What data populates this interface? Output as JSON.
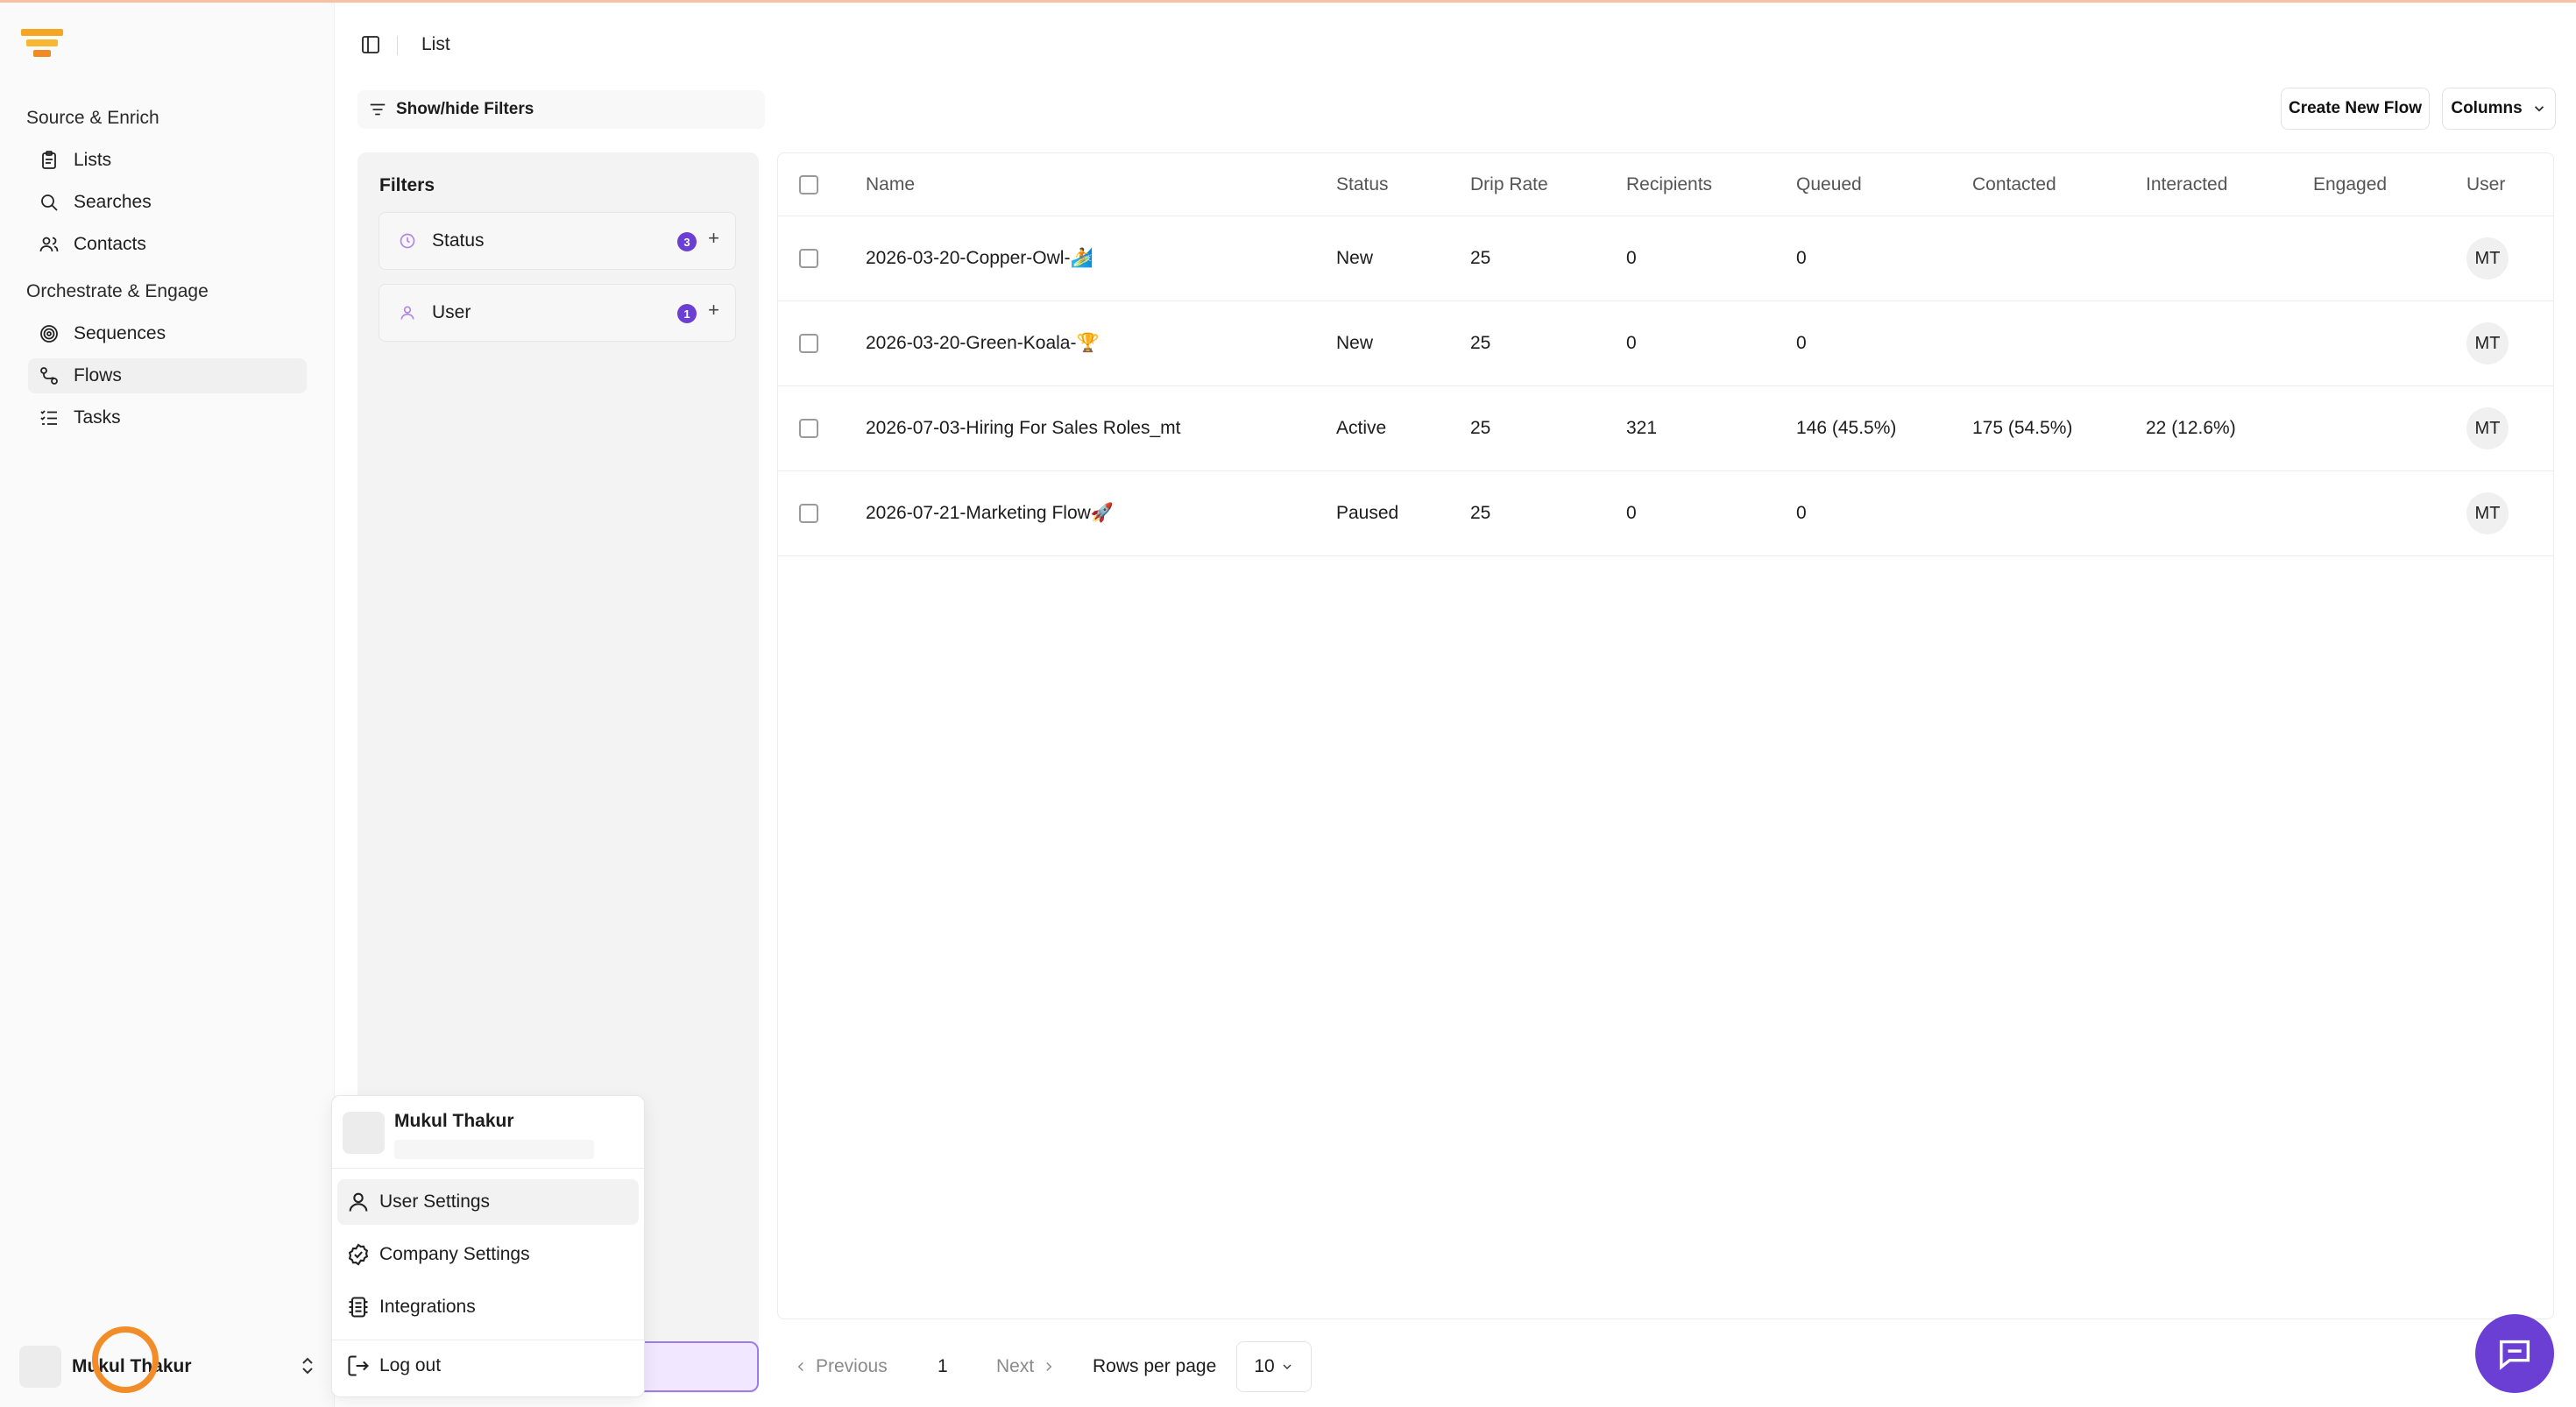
{
  "sidebar": {
    "groups": [
      {
        "label": "Source & Enrich",
        "items": [
          {
            "label": "Lists"
          },
          {
            "label": "Searches"
          },
          {
            "label": "Contacts"
          }
        ]
      },
      {
        "label": "Orchestrate & Engage",
        "items": [
          {
            "label": "Sequences"
          },
          {
            "label": "Flows"
          },
          {
            "label": "Tasks"
          }
        ]
      }
    ],
    "active_item": "Flows",
    "user_name": "Mukul Thakur"
  },
  "header": {
    "breadcrumb": "List"
  },
  "toolbar": {
    "filters_toggle": "Show/hide Filters",
    "create_label": "Create New Flow",
    "columns_label": "Columns"
  },
  "filters": {
    "title": "Filters",
    "items": [
      {
        "label": "Status",
        "count": "3"
      },
      {
        "label": "User",
        "count": "1"
      }
    ]
  },
  "table": {
    "columns": [
      "Name",
      "Status",
      "Drip Rate",
      "Recipients",
      "Queued",
      "Contacted",
      "Interacted",
      "Engaged",
      "User"
    ],
    "rows": [
      {
        "name": "2026-03-20-Copper-Owl-🏄",
        "status": "New",
        "drip": "25",
        "recipients": "0",
        "queued": "0",
        "contacted": "",
        "interacted": "",
        "engaged": "",
        "user": "MT"
      },
      {
        "name": "2026-03-20-Green-Koala-🏆",
        "status": "New",
        "drip": "25",
        "recipients": "0",
        "queued": "0",
        "contacted": "",
        "interacted": "",
        "engaged": "",
        "user": "MT"
      },
      {
        "name": "2026-07-03-Hiring For Sales Roles_mt",
        "status": "Active",
        "drip": "25",
        "recipients": "321",
        "queued": "146 (45.5%)",
        "contacted": "175 (54.5%)",
        "interacted": "22 (12.6%)",
        "engaged": "",
        "user": "MT"
      },
      {
        "name": "2026-07-21-Marketing Flow🚀",
        "status": "Paused",
        "drip": "25",
        "recipients": "0",
        "queued": "0",
        "contacted": "",
        "interacted": "",
        "engaged": "",
        "user": "MT"
      }
    ]
  },
  "pagination": {
    "previous": "Previous",
    "page": "1",
    "next": "Next",
    "rows_per_page_label": "Rows per page",
    "rows_per_page": "10"
  },
  "user_menu": {
    "name": "Mukul Thakur",
    "items": [
      {
        "label": "User Settings",
        "icon": "user-icon"
      },
      {
        "label": "Company Settings",
        "icon": "check-circle-icon"
      },
      {
        "label": "Integrations",
        "icon": "integrations-icon"
      },
      {
        "label": "Log out",
        "icon": "logout-icon"
      }
    ]
  },
  "colors": {
    "accent": "#6b3fd4",
    "logo_orange": "#f5a623",
    "cursor": "#f28c28"
  }
}
